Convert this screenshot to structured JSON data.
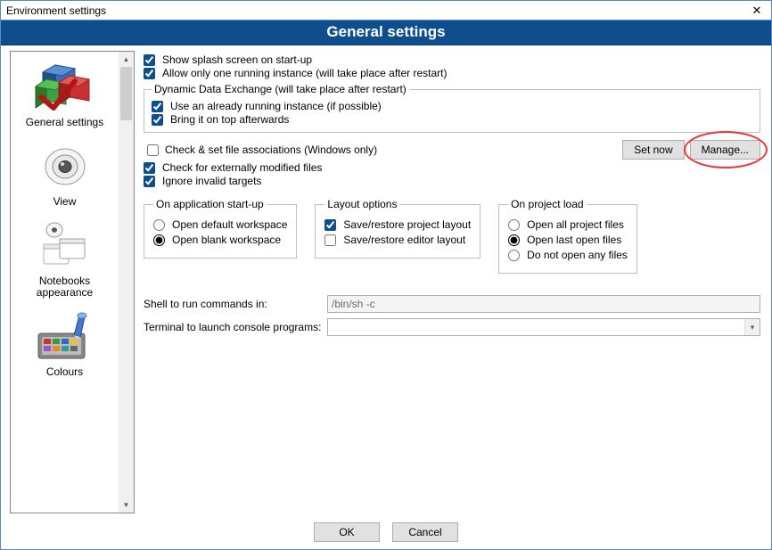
{
  "window": {
    "title": "Environment settings",
    "close_symbol": "✕"
  },
  "header": {
    "title": "General settings"
  },
  "sidebar": {
    "items": [
      {
        "label": "General settings",
        "icon": "general-settings-icon"
      },
      {
        "label": "View",
        "icon": "view-icon"
      },
      {
        "label": "Notebooks appearance",
        "icon": "notebooks-icon"
      },
      {
        "label": "Colours",
        "icon": "colours-icon"
      }
    ]
  },
  "checks": {
    "splash": {
      "label": "Show splash screen on start-up",
      "checked": true
    },
    "single_instance": {
      "label": "Allow only one running instance (will take place after restart)",
      "checked": true
    },
    "dde_legend": "Dynamic Data Exchange (will take place after restart)",
    "dde_use_running": {
      "label": "Use an already running instance (if possible)",
      "checked": true
    },
    "dde_bring_top": {
      "label": "Bring it on top afterwards",
      "checked": true
    },
    "file_assoc": {
      "label": "Check & set file associations (Windows only)",
      "checked": false
    },
    "ext_modified": {
      "label": "Check for externally modified files",
      "checked": true
    },
    "ignore_targets": {
      "label": "Ignore invalid targets",
      "checked": true
    }
  },
  "buttons": {
    "set_now": "Set now",
    "manage": "Manage...",
    "ok": "OK",
    "cancel": "Cancel"
  },
  "groups": {
    "startup": {
      "legend": "On application start-up",
      "default_ws": "Open default workspace",
      "blank_ws": "Open blank workspace",
      "selected": "blank"
    },
    "layout": {
      "legend": "Layout options",
      "project": {
        "label": "Save/restore project layout",
        "checked": true
      },
      "editor": {
        "label": "Save/restore editor layout",
        "checked": false
      }
    },
    "project_load": {
      "legend": "On project load",
      "open_all": "Open all project files",
      "open_last": "Open last open files",
      "open_none": "Do not open any files",
      "selected": "last"
    }
  },
  "fields": {
    "shell": {
      "label": "Shell to run commands in:",
      "value": "/bin/sh -c"
    },
    "terminal": {
      "label": "Terminal to launch console programs:",
      "value": ""
    }
  },
  "scroll": {
    "up": "▲",
    "down": "▼"
  }
}
